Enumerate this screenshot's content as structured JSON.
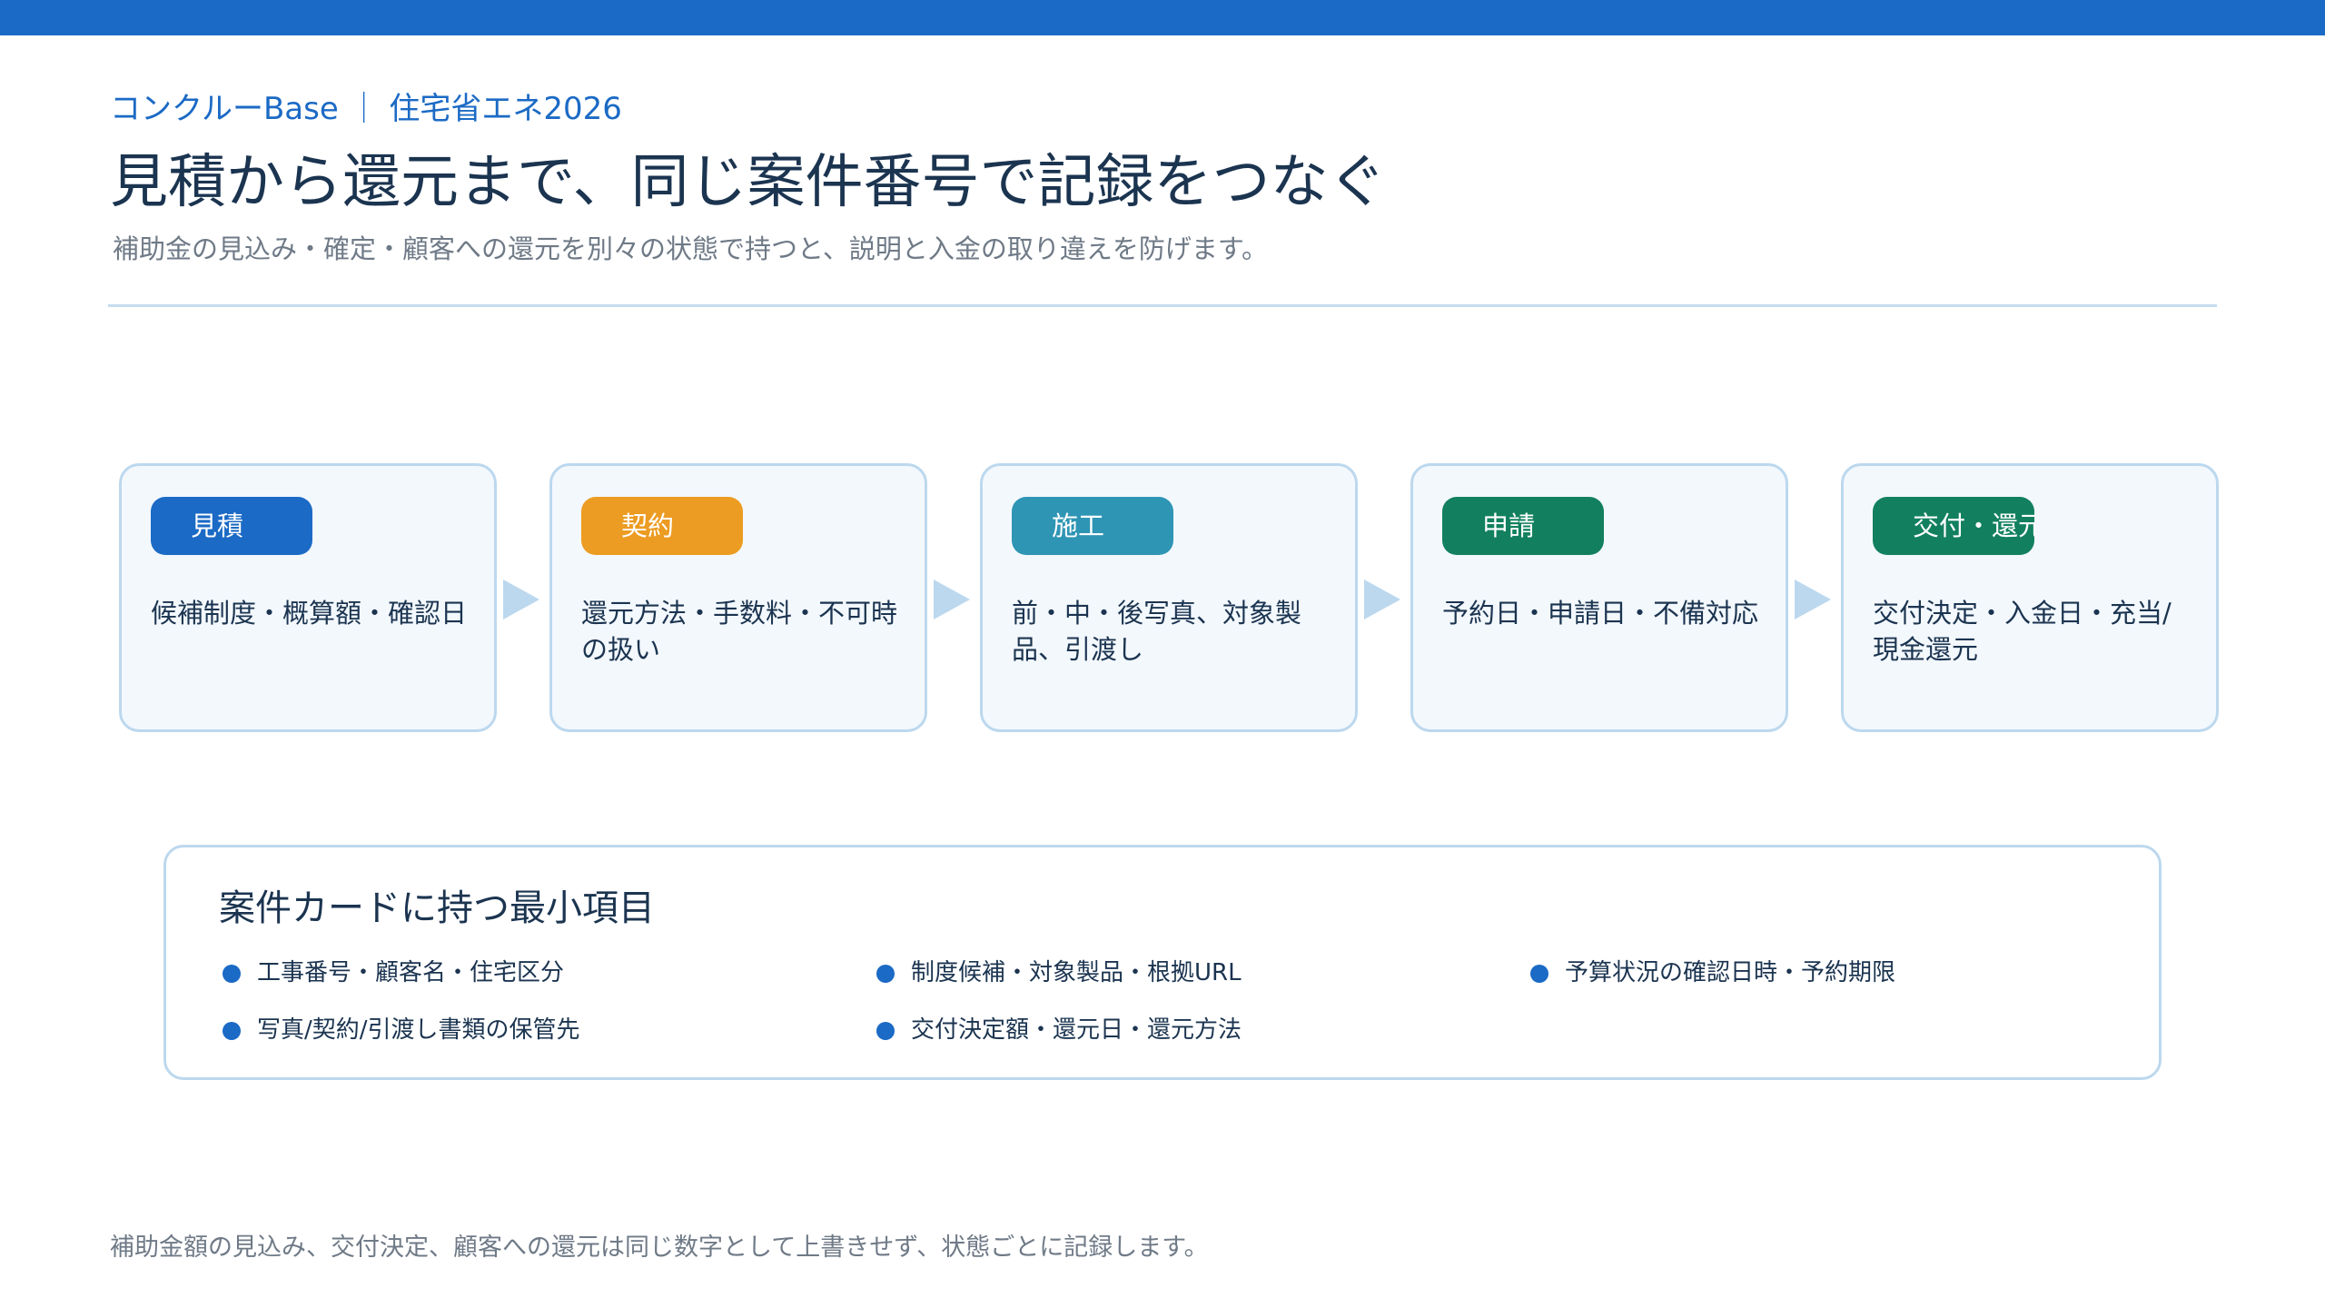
{
  "header": {
    "eyebrow": "コンクルーBase ｜ 住宅省エネ2026",
    "title": "見積から還元まで、同じ案件番号で記録をつなぐ",
    "subtitle": "補助金の見込み・確定・顧客への還元を別々の状態で持つと、説明と入金の取り違えを防げます。"
  },
  "steps": [
    {
      "label": "見積",
      "color": "#1b6ac5",
      "desc": "候補制度・概算額・確認日"
    },
    {
      "label": "契約",
      "color": "#ec9c22",
      "desc": "還元方法・手数料・不可時の扱い"
    },
    {
      "label": "施工",
      "color": "#2e95b4",
      "desc": "前・中・後写真、対象製品、引渡し"
    },
    {
      "label": "申請",
      "color": "#12805e",
      "desc": "予約日・申請日・不備対応"
    },
    {
      "label": "交付・還元",
      "color": "#12805e",
      "desc": "交付決定・入金日・充当/現金還元"
    }
  ],
  "card": {
    "title": "案件カードに持つ最小項目",
    "items": [
      "工事番号・顧客名・住宅区分",
      "制度候補・対象製品・根拠URL",
      "予算状況の確認日時・予約期限",
      "写真/契約/引渡し書類の保管先",
      "交付決定額・還元日・還元方法"
    ]
  },
  "footer": "補助金額の見込み、交付決定、顧客への還元は同じ数字として上書きせず、状態ごとに記録します。"
}
